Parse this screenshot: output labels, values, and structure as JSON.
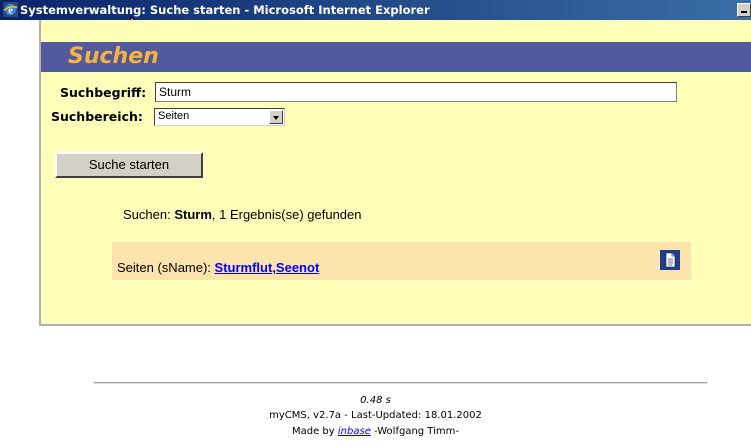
{
  "window": {
    "title": "Systemverwaltung: Suche starten - Microsoft Internet Explorer",
    "icon": "ie-logo-icon"
  },
  "page": {
    "heading": "Suchen"
  },
  "form": {
    "search_term_label": "Suchbegriff:",
    "search_term_value": "Sturm",
    "search_area_label": "Suchbereich:",
    "search_area_selected": "Seiten",
    "submit_label": "Suche starten"
  },
  "results": {
    "prefix": "Suchen:",
    "query": "Sturm",
    "count_text": ", 1 Ergebnis(se) gefunden",
    "rows": [
      {
        "label": "Seiten (sName):",
        "link_text": "Sturmflut,Seenot",
        "icon": "document-icon"
      }
    ]
  },
  "footer": {
    "time": "0.48 s",
    "version": "myCMS, v2.7a - Last-Updated: 18.01.2002",
    "made_by_prefix": "Made by",
    "brand": "inbase",
    "author": "-Wolfgang Timm-"
  },
  "colors": {
    "titlebar_start": "#0a246a",
    "titlebar_end": "#3a6ea5",
    "panel_background": "#ffffb9",
    "header_band": "#52599d",
    "heading_text": "#f7b33c",
    "result_band": "#fde4ad",
    "link": "#0000ff"
  }
}
